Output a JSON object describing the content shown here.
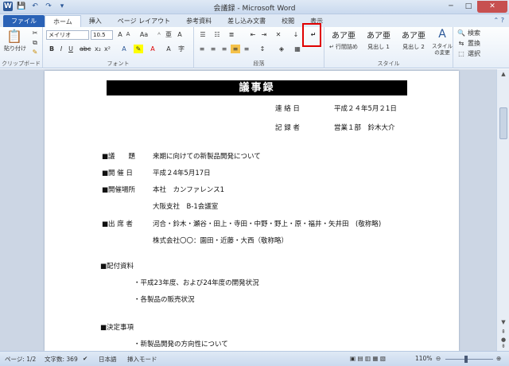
{
  "window": {
    "title": "会議録 - Microsoft Word",
    "quick_access": [
      "W",
      "💾",
      "↶",
      "↷",
      "▾"
    ],
    "controls": {
      "minimize": "─",
      "maximize": "□",
      "close": "✕"
    }
  },
  "tabs": [
    {
      "label": "ファイル"
    },
    {
      "label": "ホーム"
    },
    {
      "label": "挿入"
    },
    {
      "label": "ページ レイアウト"
    },
    {
      "label": "参考資料"
    },
    {
      "label": "差し込み文書"
    },
    {
      "label": "校閲"
    },
    {
      "label": "表示"
    }
  ],
  "ribbon": {
    "clipboard": {
      "label": "クリップボード",
      "paste": "貼り付け"
    },
    "font": {
      "label": "フォント",
      "name": "メイリオ",
      "size": "10.5"
    },
    "paragraph": {
      "label": "段落"
    },
    "styles": {
      "label": "スタイル",
      "tiles": [
        {
          "sample": "あア亜",
          "name": "↵ 行間詰め"
        },
        {
          "sample": "あア亜",
          "name": "見出し 1"
        },
        {
          "sample": "あア亜",
          "name": "見出し 2"
        }
      ],
      "change": "スタイルの変更"
    },
    "editing": {
      "find": "検索",
      "replace": "置換",
      "select": "選択"
    }
  },
  "document": {
    "title": "議事録",
    "contact_label": "連 絡 日",
    "contact_value": "平成２４年5月２1日",
    "recorder_label": "記 録 者",
    "recorder_value": "営業１部　鈴木大介",
    "agenda_label": "■議　　題",
    "agenda_value": "来期に向けての新製品開発について",
    "date_label": "■開 催 日",
    "date_value": "平成２4年5月17日",
    "venue_label": "■開催場所",
    "venue_value1": "本社　カンファレンス1",
    "venue_value2": "大阪支社　B-1会議室",
    "attendees_label": "■出 席 者",
    "attendees_value1": "河合・鈴木・瀬谷・田上・寺田・中野・野上・原・福井・矢井田　(敬称略)",
    "attendees_value2": "株式会社〇〇：園田・近藤・大西（敬称略）",
    "handouts_label": "■配付資料",
    "handout_item1": "・平成23年度、および24年度の開発状況",
    "handout_item2": "・各製品の販売状況",
    "decisions_label": "■決定事項",
    "decision_item1": "・新製品開発の方向性について"
  },
  "statusbar": {
    "page": "ページ: 1/2",
    "words": "文字数: 369",
    "language": "日本語",
    "mode": "挿入モード",
    "zoom": "110%"
  }
}
